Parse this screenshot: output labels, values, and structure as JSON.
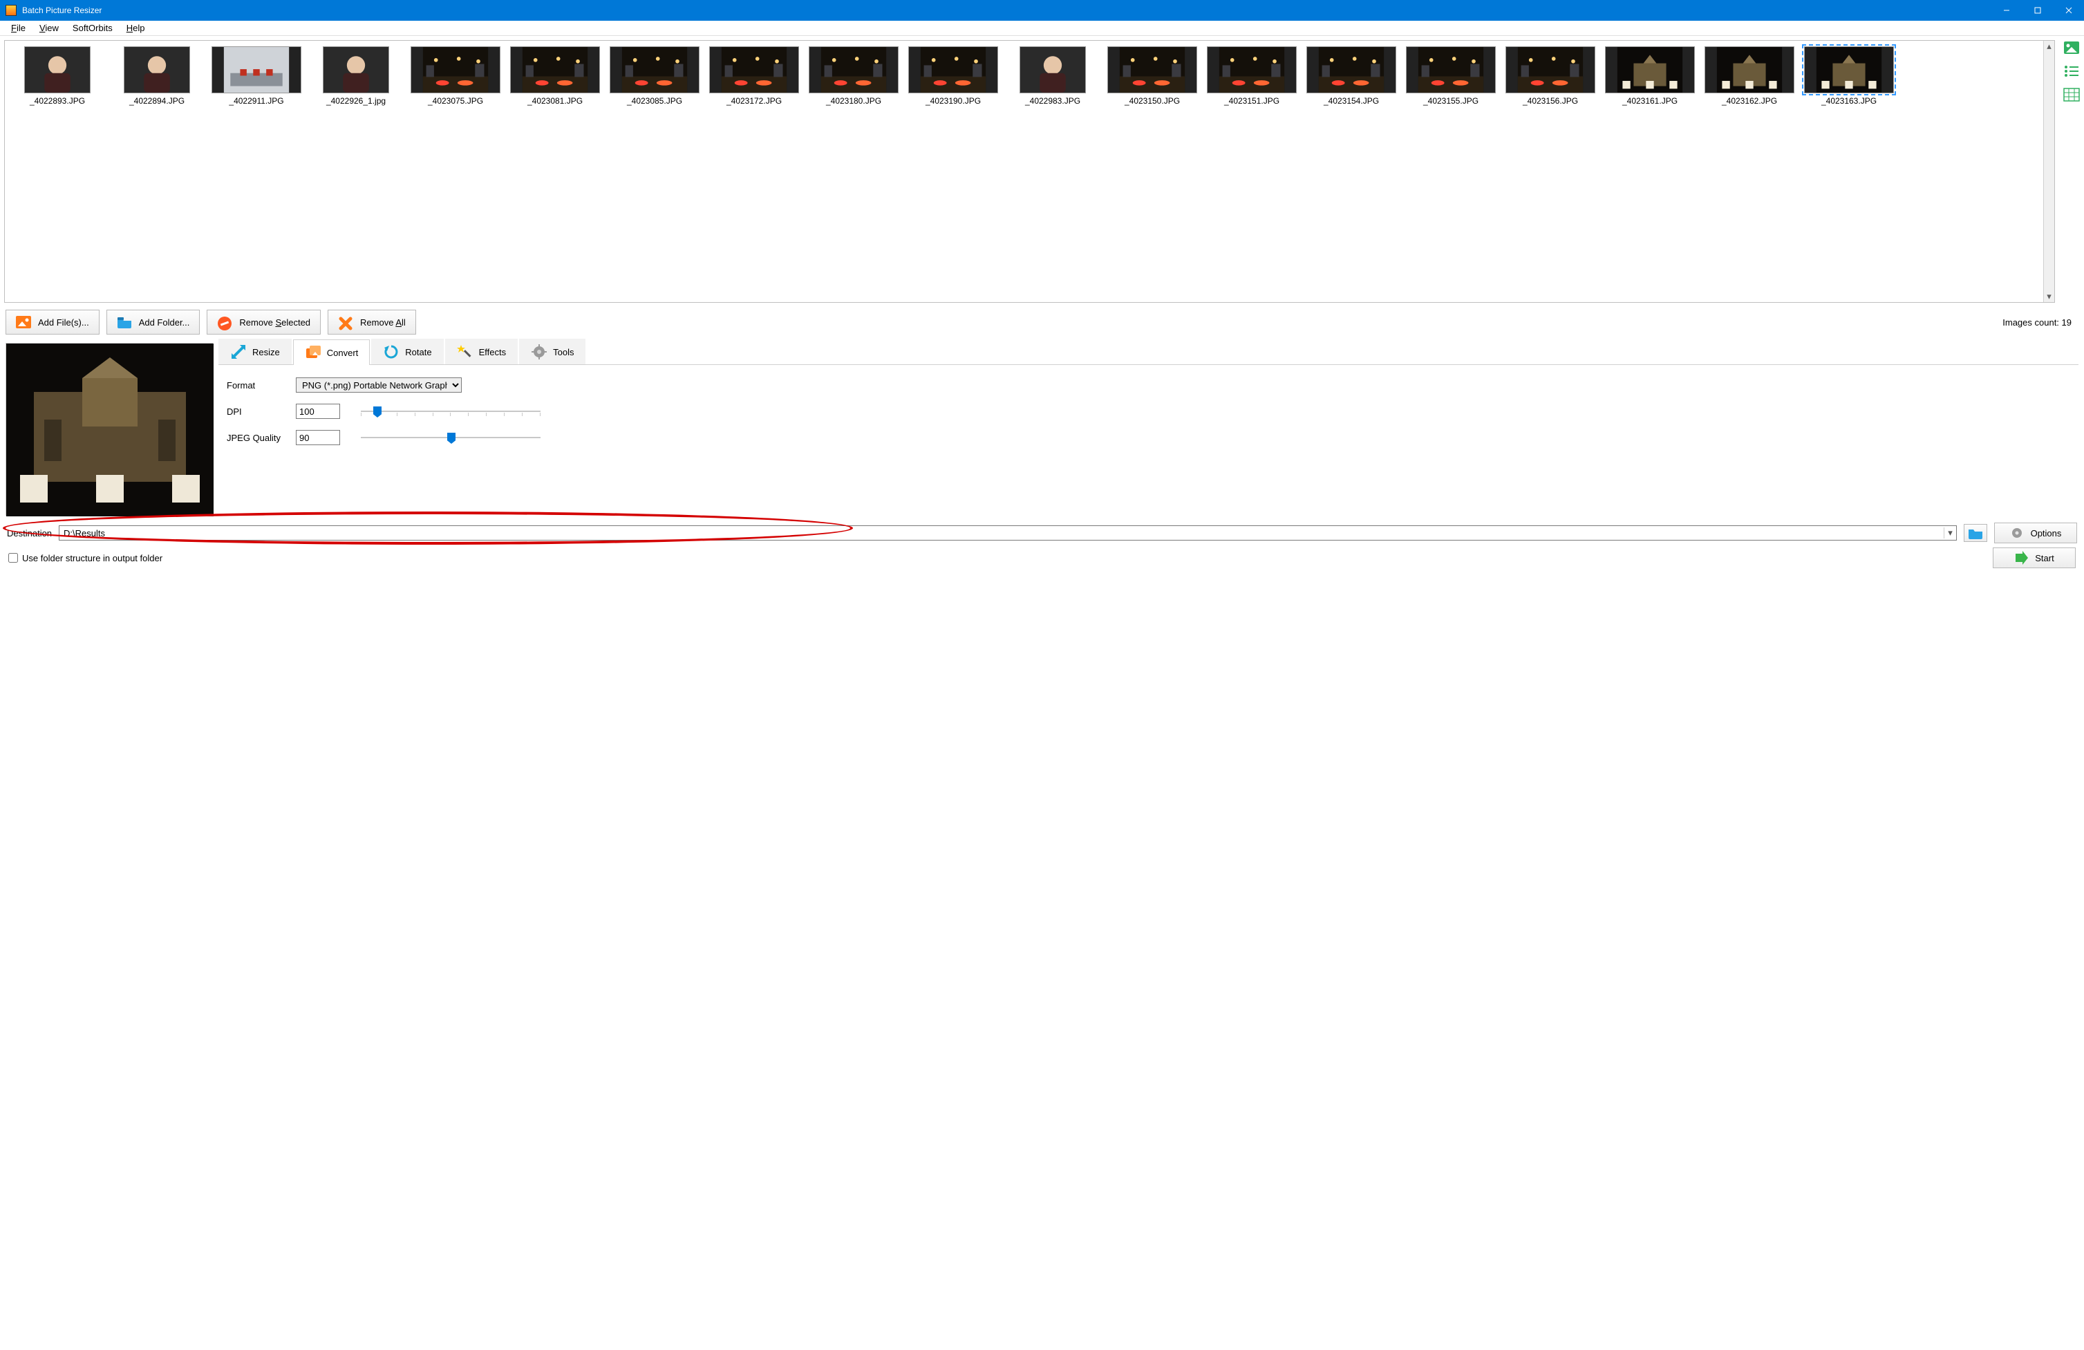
{
  "window": {
    "title": "Batch Picture Resizer"
  },
  "menu": {
    "file": "File",
    "view": "View",
    "softorbits": "SoftOrbits",
    "help": "Help"
  },
  "thumbs": [
    "_4022893.JPG",
    "_4022894.JPG",
    "_4022911.JPG",
    "_4022926_1.jpg",
    "_4023075.JPG",
    "_4023081.JPG",
    "_4023085.JPG",
    "_4023172.JPG",
    "_4023180.JPG",
    "_4023190.JPG",
    "_4022983.JPG",
    "_4023150.JPG",
    "_4023151.JPG",
    "_4023154.JPG",
    "_4023155.JPG",
    "_4023156.JPG",
    "_4023161.JPG",
    "_4023162.JPG",
    "_4023163.JPG"
  ],
  "toolbar": {
    "add_files": "Add File(s)...",
    "add_folder": "Add Folder...",
    "remove_selected": "Remove Selected",
    "remove_all": "Remove All",
    "count_label": "Images count: 19"
  },
  "tabs": {
    "resize": "Resize",
    "convert": "Convert",
    "rotate": "Rotate",
    "effects": "Effects",
    "tools": "Tools"
  },
  "convert": {
    "format_label": "Format",
    "format_value": "PNG (*.png) Portable Network Graph",
    "dpi_label": "DPI",
    "dpi_value": "100",
    "jpeg_label": "JPEG Quality",
    "jpeg_value": "90"
  },
  "dest": {
    "label": "Destination",
    "path": "D:\\Results",
    "folder_struct": "Use folder structure in output folder"
  },
  "buttons": {
    "options": "Options",
    "start": "Start"
  }
}
